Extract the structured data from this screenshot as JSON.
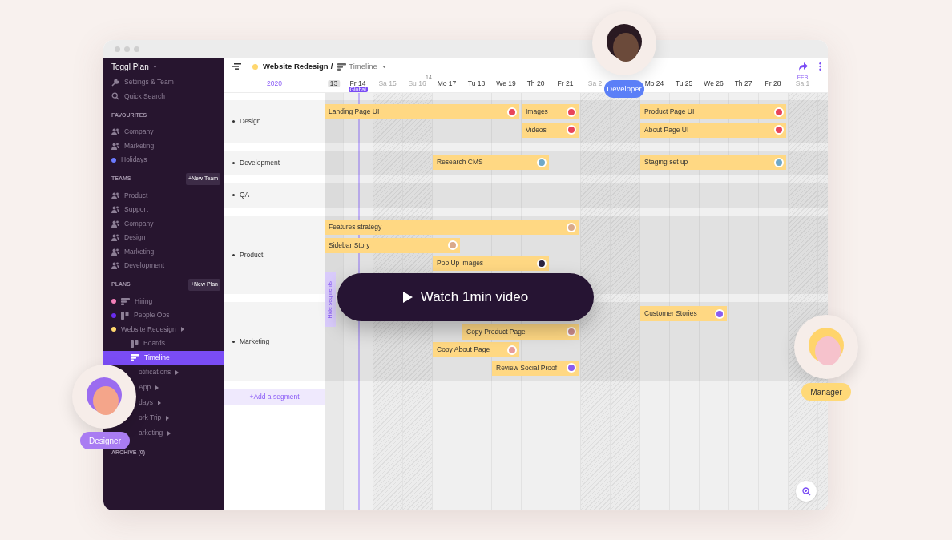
{
  "sidebar": {
    "title": "Toggl Plan",
    "tools": [
      {
        "label": "Settings & Team",
        "kind": "wrench",
        "selected": false
      },
      {
        "label": "Quick Search",
        "kind": "search",
        "selected": false
      }
    ],
    "sections": [
      {
        "title": "FAVOURITES",
        "items": [
          {
            "label": "Company",
            "kind": "team",
            "selected": false
          },
          {
            "label": "Marketing",
            "kind": "team",
            "selected": false
          },
          {
            "label": "Holidays",
            "kind": "dot",
            "color": "#6b7bff",
            "selected": false
          }
        ]
      },
      {
        "title": "TEAMS",
        "button": "+New Team",
        "items": [
          {
            "label": "Product",
            "kind": "team",
            "selected": false
          },
          {
            "label": "Support",
            "kind": "team",
            "selected": false
          },
          {
            "label": "Company",
            "kind": "team",
            "selected": false
          },
          {
            "label": "Design",
            "kind": "team",
            "selected": false
          },
          {
            "label": "Marketing",
            "kind": "team",
            "selected": false
          },
          {
            "label": "Development",
            "kind": "team",
            "selected": false
          }
        ]
      },
      {
        "title": "PLANS",
        "button": "+New Plan",
        "items": [
          {
            "label": "Hiring",
            "kind": "timeline",
            "color": "#f27fb8",
            "selected": false
          },
          {
            "label": "People Ops",
            "kind": "board",
            "color": "#6a2cf0",
            "selected": false
          },
          {
            "label": "Website Redesign",
            "kind": "dot",
            "color": "#ffd76e",
            "submenu": true,
            "selected": false,
            "children": [
              {
                "label": "Boards",
                "kind": "board",
                "selected": false
              },
              {
                "label": "Timeline",
                "kind": "timeline",
                "selected": true
              }
            ]
          },
          {
            "label": "otifications",
            "kind": "plain",
            "submenu": true,
            "selected": false
          },
          {
            "label": "App",
            "kind": "plain",
            "submenu": true,
            "selected": false
          },
          {
            "label": "days",
            "kind": "plain",
            "submenu": true,
            "selected": false
          },
          {
            "label": "ork Trip",
            "kind": "plain",
            "submenu": true,
            "selected": false
          },
          {
            "label": "arketing",
            "kind": "plain",
            "submenu": true,
            "selected": false
          }
        ]
      },
      {
        "title": "ARCHIVE (0)"
      }
    ]
  },
  "header": {
    "project": {
      "label": "Website Redesign",
      "color": "#ffd76e"
    },
    "separator": "/",
    "view": "Timeline"
  },
  "year": "2020",
  "days": [
    {
      "label": "13",
      "weekend": false,
      "today": true
    },
    {
      "label": "Fr 14",
      "weekend": false,
      "today": false
    },
    {
      "label": "Sa 15",
      "weekend": true,
      "today": false
    },
    {
      "label": "Su 16",
      "weekend": true,
      "today": false
    },
    {
      "label": "Mo 17",
      "weekend": false,
      "today": false,
      "week": "14"
    },
    {
      "label": "Tu 18",
      "weekend": false,
      "today": false
    },
    {
      "label": "We 19",
      "weekend": false,
      "today": false
    },
    {
      "label": "Th 20",
      "weekend": false,
      "today": false
    },
    {
      "label": "Fr 21",
      "weekend": false,
      "today": false
    },
    {
      "label": "Sa 2",
      "weekend": true,
      "today": false
    },
    {
      "weekend": true,
      "today": false
    },
    {
      "label": "Mo 24",
      "weekend": false,
      "today": false
    },
    {
      "label": "Tu 25",
      "weekend": false,
      "today": false
    },
    {
      "label": "We 26",
      "weekend": false,
      "today": false
    },
    {
      "label": "Th 27",
      "weekend": false,
      "today": false
    },
    {
      "label": "Fr 28",
      "weekend": false,
      "today": false
    },
    {
      "label": "Sa 1",
      "weekend": true,
      "today": false,
      "month": "FEB"
    },
    {
      "weekend": true,
      "today": false
    }
  ],
  "marker": {
    "label": "Global"
  },
  "segments": [
    {
      "name": "Design",
      "lanes": [
        [
          {
            "title": "Landing Page UI",
            "color": "#e8455a"
          },
          {
            "title": "Images",
            "color": "#e8455a"
          },
          {
            "title": "Product Page UI",
            "color": "#e8455a"
          }
        ],
        [
          {
            "title": "Videos",
            "color": "#e8455a"
          },
          {
            "title": "About Page UI",
            "color": "#e8455a"
          }
        ]
      ]
    },
    {
      "name": "Development",
      "lanes": [
        [
          {
            "title": "Research CMS",
            "color": "#6fa8c8"
          },
          {
            "title": "Staging set up",
            "color": "#6fa8c8"
          }
        ]
      ]
    },
    {
      "name": "QA"
    },
    {
      "name": "Product",
      "lanes": [
        [
          {
            "title": "Features strategy",
            "color": "#d9a98a"
          }
        ],
        [
          {
            "title": "Sidebar Story",
            "color": "#d9a98a"
          }
        ],
        [
          {
            "title": "Pop Up images",
            "color": "#2b2440"
          }
        ]
      ]
    },
    {
      "name": "Marketing",
      "lanes": [
        [
          {
            "title": "Customer Stories",
            "color": "#8a5cf0"
          }
        ],
        [
          {
            "title": "Copy Product Page",
            "color": "#c98a8a"
          }
        ],
        [
          {
            "title": "Copy About Page",
            "color": "#e79b9b"
          }
        ],
        [
          {
            "title": "Review Social Proof",
            "color": "#8a5cf0"
          }
        ]
      ]
    }
  ],
  "add_segment": "+Add a segment",
  "hide_segments": "Hide segments",
  "video_button": "Watch 1min video",
  "people": [
    {
      "role": "Developer",
      "kind": "developer",
      "color": "#5b7ff7"
    },
    {
      "role": "Designer",
      "kind": "designer",
      "color": "#a97cf2"
    },
    {
      "role": "Manager",
      "kind": "manager",
      "color": "#ffd978"
    }
  ]
}
